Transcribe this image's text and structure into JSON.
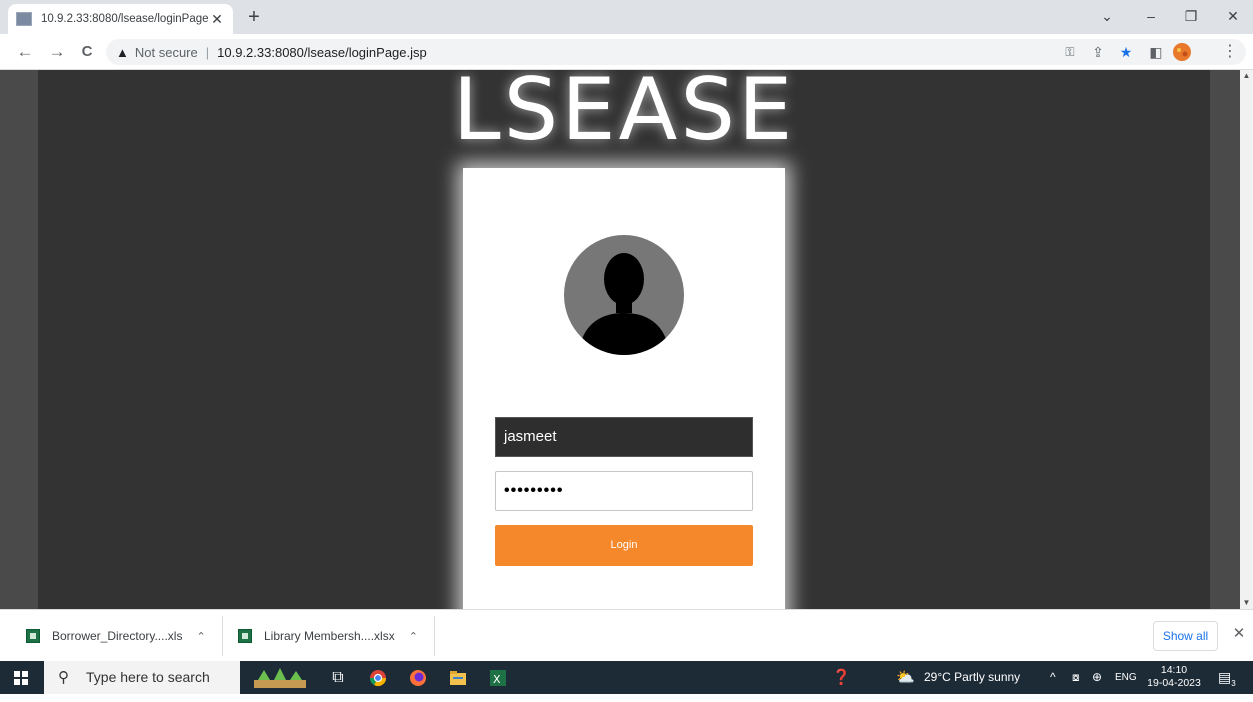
{
  "browser": {
    "tab_title": "10.9.2.33:8080/lsease/loginPage.",
    "tab_close": "✕",
    "new_tab": "+",
    "window_controls": [
      "⌄",
      "–",
      "❐",
      "✕"
    ],
    "nav": {
      "back": "←",
      "forward": "→",
      "reload": "C"
    },
    "security_label": "Not secure",
    "url": "10.9.2.33:8080/lsease/loginPage.jsp",
    "url_separator": "|"
  },
  "page": {
    "logo": "LSEASE",
    "username_value": "jasmeet",
    "password_mask": "•••••••••",
    "login_label": "Login"
  },
  "downloads": {
    "items": [
      {
        "label": "Borrower_Directory....xls"
      },
      {
        "label": "Library Membersh....xlsx"
      }
    ],
    "show_all": "Show all",
    "close": "✕"
  },
  "taskbar": {
    "search_placeholder": "Type here to search",
    "weather": "29°C  Partly sunny",
    "language": "ENG",
    "time": "14:10",
    "date": "19-04-2023",
    "notification_count": "3"
  }
}
